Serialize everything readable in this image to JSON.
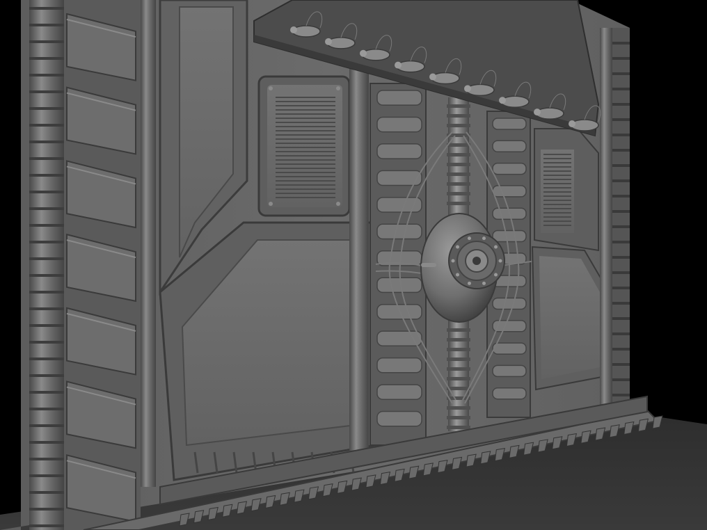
{
  "viewport": {
    "background": "#000000",
    "render_mode": "matcap-clay"
  },
  "subject": {
    "kind": "sci-fi-wall-panel-sculpt",
    "surface_color": "#6e6e6e",
    "highlight_color": "#9a9a9a",
    "shadow_color": "#3a3a3a",
    "floor_color": "#2a2a2a"
  },
  "details": {
    "left_column_segments": 7,
    "top_rail_light_pods": 9,
    "side_vent_slats": 13,
    "base_tooth_count": 34
  }
}
